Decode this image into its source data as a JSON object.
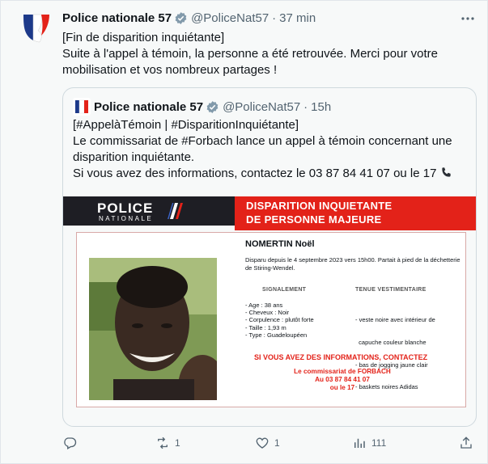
{
  "tweet": {
    "author_name": "Police nationale 57",
    "handle": "@PoliceNat57",
    "separator": "·",
    "time": "37 min",
    "lines": [
      "[Fin de disparition inquiétante]",
      "Suite à l'appel à témoin, la personne a été retrouvée. Merci pour votre",
      "mobilisation et vos nombreux partages !"
    ]
  },
  "quote": {
    "author_name": "Police nationale 57",
    "handle": "@PoliceNat57",
    "separator": "·",
    "time": "15h",
    "lines": [
      "[#AppelàTémoin | #DisparitionInquiétante]",
      "Le commissariat de #Forbach lance un appel à témoin concernant une",
      "disparition inquiétante.",
      "Si vous avez des informations, contactez le 03 87 84 41 07 ou le 17"
    ],
    "poster": {
      "logo_police": "POLICE",
      "logo_nationale": "NATIONALE",
      "banner_line1": "DISPARITION INQUIETANTE",
      "banner_line2": "DE PERSONNE MAJEURE",
      "person_name": "NOMERTIN Noël",
      "description": "Disparu depuis le 4 septembre 2023 vers 15h00. Partait à pied de la déchetterie de Stiring-Wendel.",
      "signalement_title": "SIGNALEMENT",
      "tenue_title": "TENUE VESTIMENTAIRE",
      "signalement": [
        "- Age : 38 ans",
        "- Cheveux : Noir",
        "- Corpulence : plutôt forte",
        "- Taille : 1,93 m",
        "- Type : Guadeloupéen"
      ],
      "tenue": [
        "- veste noire avec intérieur de",
        "  capuche couleur blanche",
        "- bas de jogging jaune clair",
        "- baskets noires Adidas"
      ],
      "cta": "SI VOUS AVEZ DES INFORMATIONS, CONTACTEZ",
      "contact_lines": [
        "Le commissariat de FORBACH",
        "Au 03 87 84 41 07",
        "ou le 17"
      ]
    }
  },
  "actions": {
    "reply_count": "",
    "retweet_count": "1",
    "like_count": "1",
    "views_count": "111"
  },
  "icons": [
    "verified-badge-icon",
    "more-icon",
    "phone-icon",
    "reply-icon",
    "retweet-icon",
    "like-icon",
    "views-icon",
    "share-icon"
  ],
  "colors": {
    "accent_blue": "#1d9bf0",
    "poster_red": "#e32219",
    "muted_text": "#536471"
  }
}
